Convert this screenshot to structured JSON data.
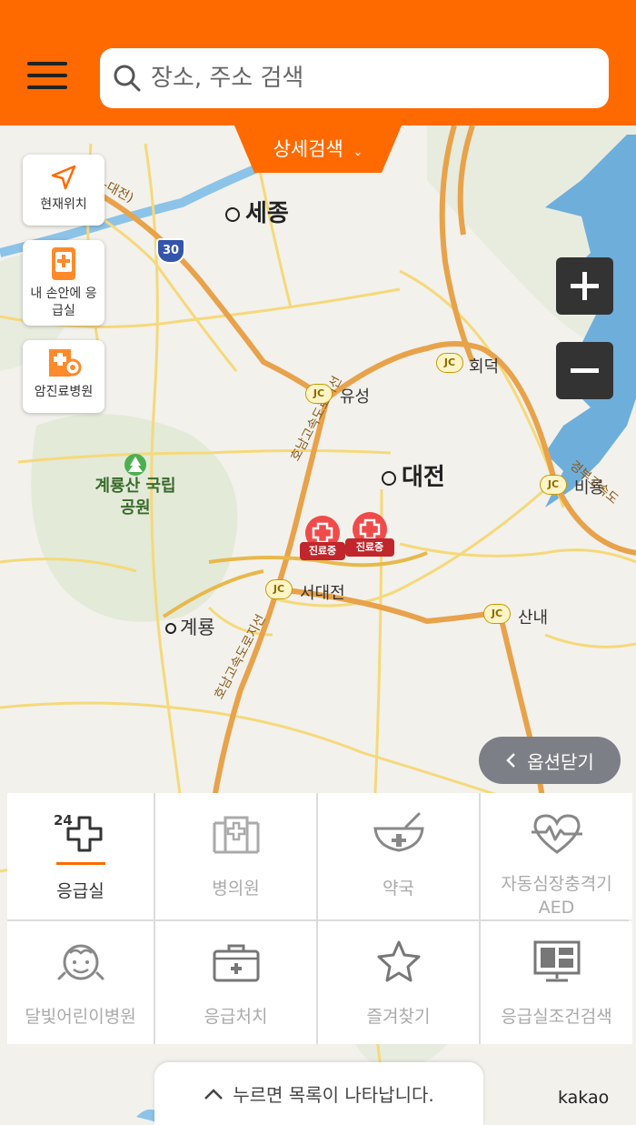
{
  "header": {
    "search_placeholder": "장소, 주소 검색",
    "detail_search_label": "상세검색",
    "brand_color": "#ff6a00"
  },
  "side_buttons": [
    {
      "label": "현재위치",
      "icon": "navigation-arrow-icon"
    },
    {
      "label": "내 손안에 응급실",
      "icon": "phone-emergency-icon"
    },
    {
      "label": "암진료병원",
      "icon": "cancer-hospital-icon"
    }
  ],
  "map": {
    "places": {
      "sejong": "세종",
      "daejeon": "대전",
      "gyeryong": "계룡",
      "gyeryongsan": "계룡산 국립공원",
      "yuseong": "유성",
      "hoedeok": "회덕",
      "biryong": "비룡",
      "seodaejeon": "서대전",
      "sannae": "산내"
    },
    "route_number": "30",
    "jc_label": "JC",
    "hospital_marker_label": "진료중",
    "road_labels": {
      "top_left": "-대전)",
      "honam_a": "호남고속도로지선",
      "honam_b": "호남고속도로지선",
      "gyeongbu": "경부고속도"
    }
  },
  "zoom": {
    "in_icon": "plus-icon",
    "out_icon": "minus-icon"
  },
  "option_close": {
    "label": "옵션닫기"
  },
  "categories": [
    {
      "label": "응급실",
      "icon": "emergency-24-icon",
      "active": true
    },
    {
      "label": "병의원",
      "icon": "hospital-icon",
      "active": false
    },
    {
      "label": "약국",
      "icon": "pharmacy-icon",
      "active": false
    },
    {
      "label": "자동심장충격기\nAED",
      "icon": "aed-heart-icon",
      "active": false
    },
    {
      "label": "달빛어린이병원",
      "icon": "child-face-icon",
      "active": false
    },
    {
      "label": "응급처치",
      "icon": "first-aid-kit-icon",
      "active": false
    },
    {
      "label": "즐겨찾기",
      "icon": "star-icon",
      "active": false
    },
    {
      "label": "응급실조건검색",
      "icon": "monitor-search-icon",
      "active": false
    }
  ],
  "bottom": {
    "list_hint": "누르면 목록이 나타납니다.",
    "brand": "kakao"
  }
}
